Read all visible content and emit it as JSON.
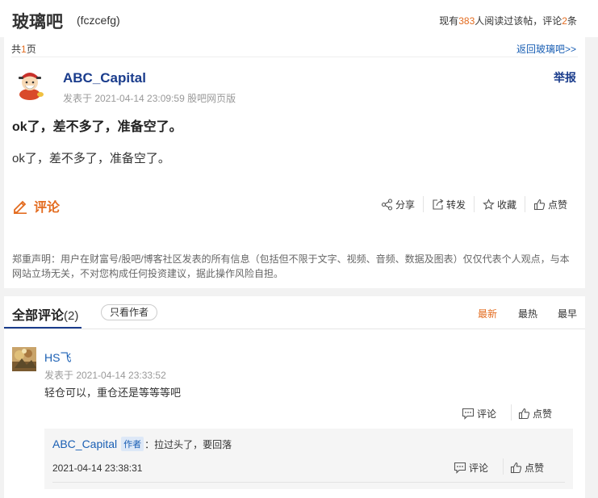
{
  "header": {
    "forum_name": "玻璃吧",
    "forum_code": "(fczcefg)",
    "stats": {
      "prefix": "现有",
      "readers": "383",
      "mid": "人阅读过该帖，评论",
      "comments": "2",
      "suffix": "条"
    }
  },
  "pagination": {
    "prefix": "共",
    "pages": "1",
    "suffix": "页",
    "back_link": "返回玻璃吧>>"
  },
  "post": {
    "author": "ABC_Capital",
    "meta": "发表于 2021-04-14 23:09:59 股吧网页版",
    "report_label": "举报",
    "title": "ok了，差不多了，准备空了。",
    "body": "ok了，差不多了，准备空了。",
    "comment_label": "评论",
    "actions": {
      "share": "分享",
      "repost": "转发",
      "favorite": "收藏",
      "like": "点赞"
    },
    "disclaimer": "郑重声明：用户在财富号/股吧/博客社区发表的所有信息（包括但不限于文字、视频、音频、数据及图表）仅仅代表个人观点，与本网站立场无关，不对您构成任何投资建议，据此操作风险自担。"
  },
  "comments_section": {
    "tab_label": "全部评论",
    "count": "(2)",
    "only_author_button": "只看作者",
    "sort": {
      "newest": "最新",
      "hottest": "最热",
      "earliest": "最早"
    },
    "active_sort_color": "#e36c20",
    "items": [
      {
        "author": "HS飞",
        "time": "发表于 2021-04-14 23:33:52",
        "text": "轻仓可以，重仓还是等等等吧",
        "comment_label": "评论",
        "like_label": "点赞",
        "reply": {
          "author": "ABC_Capital",
          "badge": "作者",
          "text": "：拉过头了，要回落",
          "time": "2021-04-14 23:38:31",
          "comment_label": "评论",
          "like_label": "点赞"
        }
      }
    ]
  },
  "colors": {
    "brand_blue": "#1a3c8c",
    "accent_orange": "#e36c20",
    "link_blue": "#1a5fb4",
    "page_bg": "#f2f2f2"
  }
}
